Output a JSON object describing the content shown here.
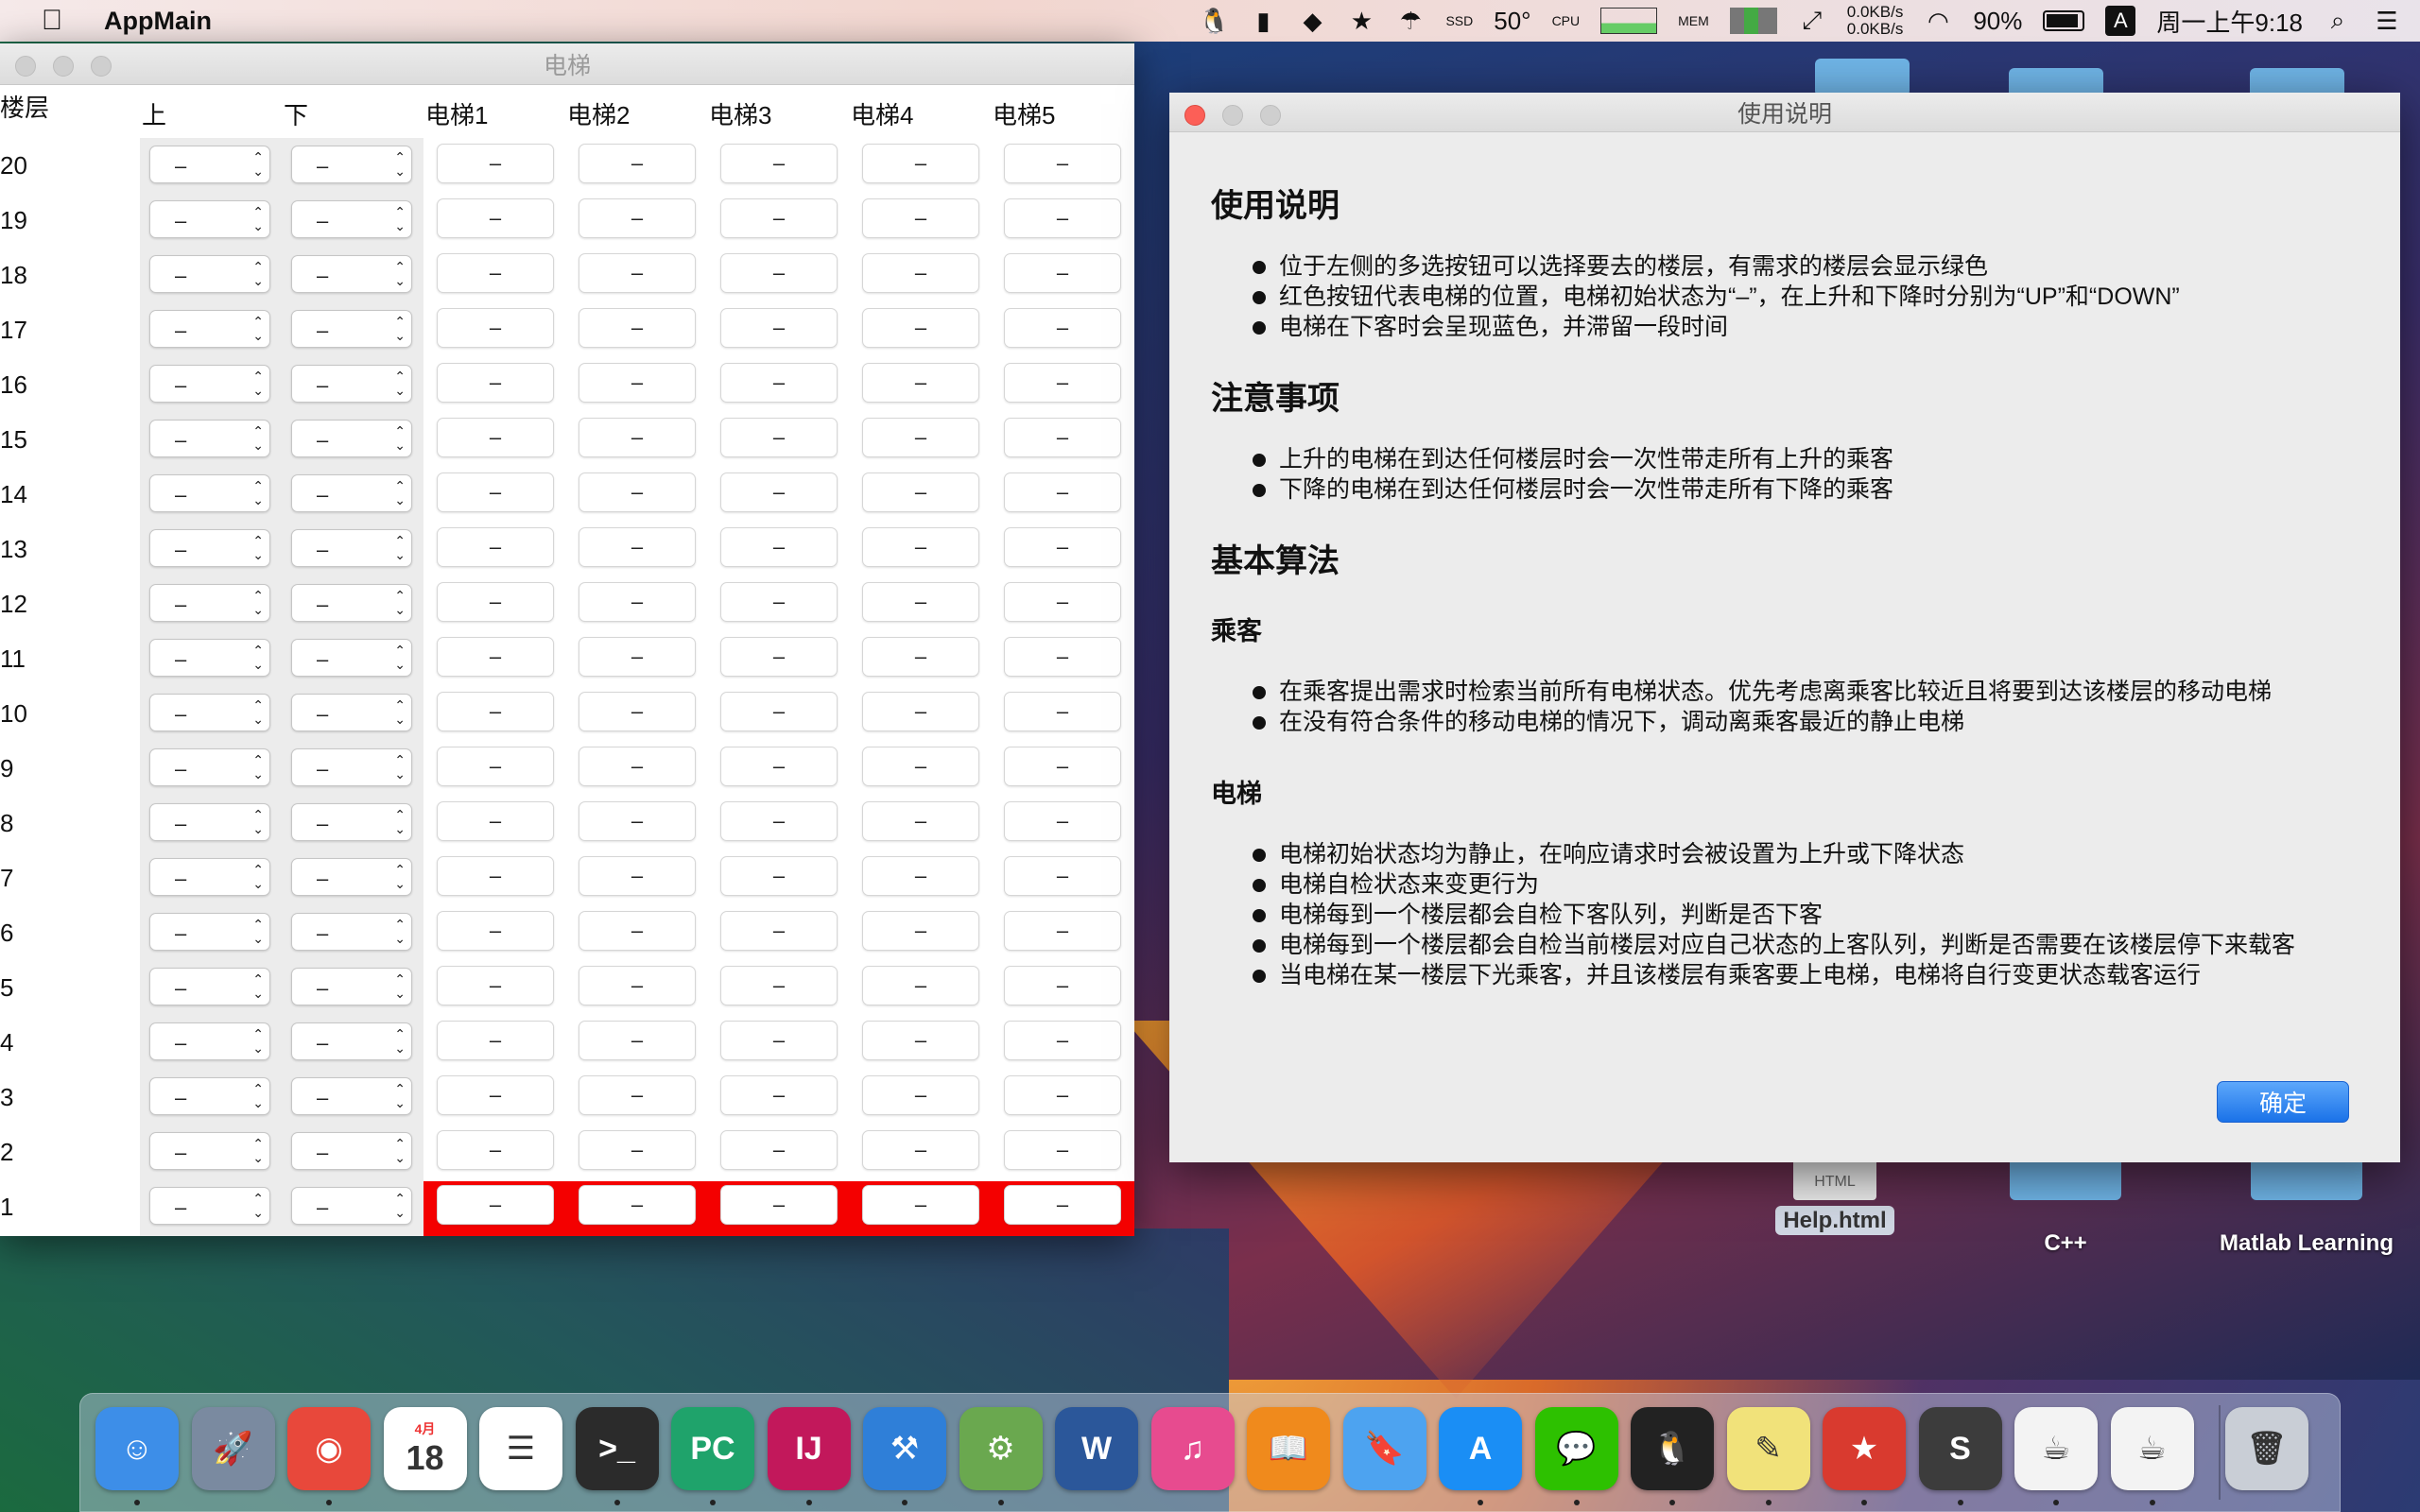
{
  "menubar": {
    "app_name": "AppMain",
    "temperature": "50°",
    "net_up": "0.0KB/s",
    "net_down": "0.0KB/s",
    "battery": "90%",
    "battery_level": 0.9,
    "input_method": "A",
    "clock": "周一上午9:18",
    "side_labels": [
      "CPU",
      "MEM",
      "SSD"
    ]
  },
  "elevator_window": {
    "title": "电梯",
    "headers": {
      "floor": "楼层",
      "up": "上",
      "down": "下",
      "elevators": [
        "电梯1",
        "电梯2",
        "电梯3",
        "电梯4",
        "电梯5"
      ]
    },
    "floors": [
      "20",
      "19",
      "18",
      "17",
      "16",
      "15",
      "14",
      "13",
      "12",
      "11",
      "10",
      "9",
      "8",
      "7",
      "6",
      "5",
      "4",
      "3",
      "2",
      "1"
    ],
    "select_value": "–",
    "elevator_state": "–",
    "elevator_position_floor": "1",
    "highlight_color": "#f40000"
  },
  "help_window": {
    "title": "使用说明",
    "sections": [
      {
        "heading": "使用说明",
        "items": [
          "位于左侧的多选按钮可以选择要去的楼层，有需求的楼层会显示绿色",
          "红色按钮代表电梯的位置，电梯初始状态为“–”，在上升和下降时分别为“UP”和“DOWN”",
          "电梯在下客时会呈现蓝色，并滞留一段时间"
        ]
      },
      {
        "heading": "注意事项",
        "items": [
          "上升的电梯在到达任何楼层时会一次性带走所有上升的乘客",
          "下降的电梯在到达任何楼层时会一次性带走所有下降的乘客"
        ]
      },
      {
        "heading": "基本算法",
        "items": []
      }
    ],
    "sub_passenger": {
      "heading": "乘客",
      "items": [
        "在乘客提出需求时检索当前所有电梯状态。优先考虑离乘客比较近且将要到达该楼层的移动电梯",
        "在没有符合条件的移动电梯的情况下，调动离乘客最近的静止电梯"
      ]
    },
    "sub_elevator": {
      "heading": "电梯",
      "items": [
        "电梯初始状态均为静止，在响应请求时会被设置为上升或下降状态",
        "电梯自检状态来变更行为",
        "电梯每到一个楼层都会自检下客队列，判断是否下客",
        "电梯每到一个楼层都会自检当前楼层对应自己状态的上客队列，判断是否需要在该楼层停下来载客",
        "当电梯在某一楼层下光乘客，并且该楼层有乘客要上电梯，电梯将自行变更状态载客运行"
      ]
    },
    "ok_button": "确定"
  },
  "desktop": {
    "icons": [
      {
        "label": "Help.html",
        "type": "HTML"
      },
      {
        "label": "C++"
      },
      {
        "label": "Matlab Learning"
      }
    ]
  },
  "dock": {
    "apps": [
      {
        "name": "finder-icon",
        "glyph": "☺",
        "color": "#3d8ee8"
      },
      {
        "name": "launchpad-icon",
        "glyph": "🚀",
        "color": "#7a8aa0"
      },
      {
        "name": "chrome-icon",
        "glyph": "◉",
        "color": "#e8483b"
      },
      {
        "name": "calendar-icon",
        "glyph": "18",
        "color": "#ffffff"
      },
      {
        "name": "reminders-icon",
        "glyph": "☰",
        "color": "#ffffff"
      },
      {
        "name": "terminal-icon",
        "glyph": ">_",
        "color": "#2b2b2b"
      },
      {
        "name": "pycharm-icon",
        "glyph": "PC",
        "color": "#1fa36b"
      },
      {
        "name": "intellij-icon",
        "glyph": "IJ",
        "color": "#c2185b"
      },
      {
        "name": "xcode-icon",
        "glyph": "⚒",
        "color": "#2f7fd8"
      },
      {
        "name": "android-studio-icon",
        "glyph": "⚙",
        "color": "#6aa84f"
      },
      {
        "name": "word-icon",
        "glyph": "W",
        "color": "#2b579a"
      },
      {
        "name": "itunes-icon",
        "glyph": "♫",
        "color": "#e74b8f"
      },
      {
        "name": "ibooks-icon",
        "glyph": "📖",
        "color": "#f08a1c"
      },
      {
        "name": "bookmark-icon",
        "glyph": "🔖",
        "color": "#4da3f0"
      },
      {
        "name": "app-store-icon",
        "glyph": "A",
        "color": "#1a8ef5"
      },
      {
        "name": "wechat-icon",
        "glyph": "💬",
        "color": "#2dc100"
      },
      {
        "name": "qq-icon",
        "glyph": "🐧",
        "color": "#222222"
      },
      {
        "name": "stickies-icon",
        "glyph": "✎",
        "color": "#f1e27a"
      },
      {
        "name": "wunderlist-icon",
        "glyph": "★",
        "color": "#d93a2f"
      },
      {
        "name": "sublime-icon",
        "glyph": "S",
        "color": "#3c3c3c"
      },
      {
        "name": "java-icon-1",
        "glyph": "☕",
        "color": "#f3f3f3"
      },
      {
        "name": "java-icon-2",
        "glyph": "☕",
        "color": "#f3f3f3"
      },
      {
        "name": "trash-icon",
        "glyph": "🗑",
        "color": "#c9ced6"
      }
    ],
    "calendar_month": "4月"
  }
}
